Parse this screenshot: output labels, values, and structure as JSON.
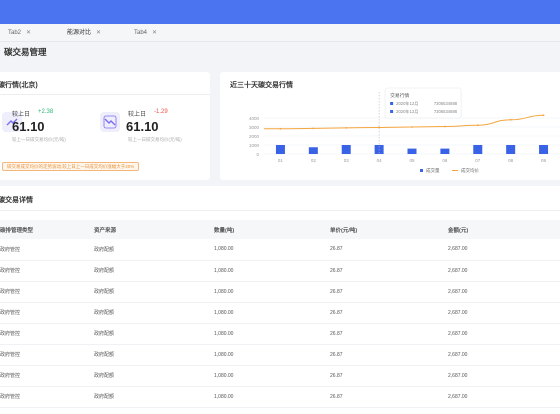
{
  "tabs": [
    {
      "label": "Tab2",
      "active": false,
      "closable": true
    },
    {
      "label": "能源对比",
      "active": true,
      "closable": true
    },
    {
      "label": "Tab4",
      "active": false,
      "closable": true
    }
  ],
  "page": {
    "title": "碳交易管理"
  },
  "market": {
    "title": "碳行情(北京)",
    "stats": [
      {
        "label": "较上日",
        "delta": "+2.38",
        "delta_color": "#2bb673",
        "value": "61.10",
        "desc": "较上一日碳交易均价(元/吨)",
        "icon": "trend-up-icon"
      },
      {
        "label": "较上日",
        "delta": "-1.29",
        "delta_color": "#f0504a",
        "value": "61.10",
        "desc": "较上一日碳交易均价(元/吨)",
        "icon": "trend-down-icon"
      }
    ],
    "notice": "碳交易成交均价的走势波动,较上日上一日成交均价涨幅大于20%"
  },
  "chart_card": {
    "title": "近三十天碳交易行情"
  },
  "chart_data": {
    "type": "bar",
    "categories": [
      "01",
      "02",
      "03",
      "04",
      "05",
      "06",
      "07",
      "08",
      "09"
    ],
    "yticks": [
      "4000",
      "3000",
      "2000",
      "1000",
      "0"
    ],
    "ylim": [
      0,
      4000
    ],
    "series": [
      {
        "name": "成交量",
        "type": "bar",
        "color": "#3a62e6",
        "values": [
          1000,
          750,
          1000,
          1000,
          600,
          600,
          1000,
          1000,
          1000
        ]
      },
      {
        "name": "成交均价",
        "type": "line",
        "color": "#f4a640",
        "values": [
          2800,
          2850,
          2900,
          2950,
          3000,
          3050,
          3200,
          3800,
          4300
        ]
      }
    ],
    "tooltip": {
      "title": "交易行情",
      "rows": [
        {
          "label": "2020年12月",
          "value": "7306534888"
        },
        {
          "label": "2020年12月",
          "value": "7306534888"
        }
      ]
    },
    "legend_position": "bottom-right"
  },
  "detail": {
    "title": "碳交易详情",
    "columns": [
      "碳排管理类型",
      "资产来源",
      "数量(吨)",
      "单价(元/吨)",
      "金额(元)"
    ],
    "rows": [
      [
        "政府管控",
        "政府配额",
        "1,080.00",
        "26.87",
        "2,687.00"
      ],
      [
        "政府管控",
        "政府配额",
        "1,080.00",
        "26.87",
        "2,687.00"
      ],
      [
        "政府管控",
        "政府配额",
        "1,080.00",
        "26.87",
        "2,687.00"
      ],
      [
        "政府管控",
        "政府配额",
        "1,080.00",
        "26.87",
        "2,687.00"
      ],
      [
        "政府管控",
        "政府配额",
        "1,080.00",
        "26.87",
        "2,687.00"
      ],
      [
        "政府管控",
        "政府配额",
        "1,080.00",
        "26.87",
        "2,687.00"
      ],
      [
        "政府管控",
        "政府配额",
        "1,080.00",
        "26.87",
        "2,687.00"
      ],
      [
        "政府管控",
        "政府配额",
        "1,080.00",
        "26.87",
        "2,687.00"
      ]
    ]
  }
}
